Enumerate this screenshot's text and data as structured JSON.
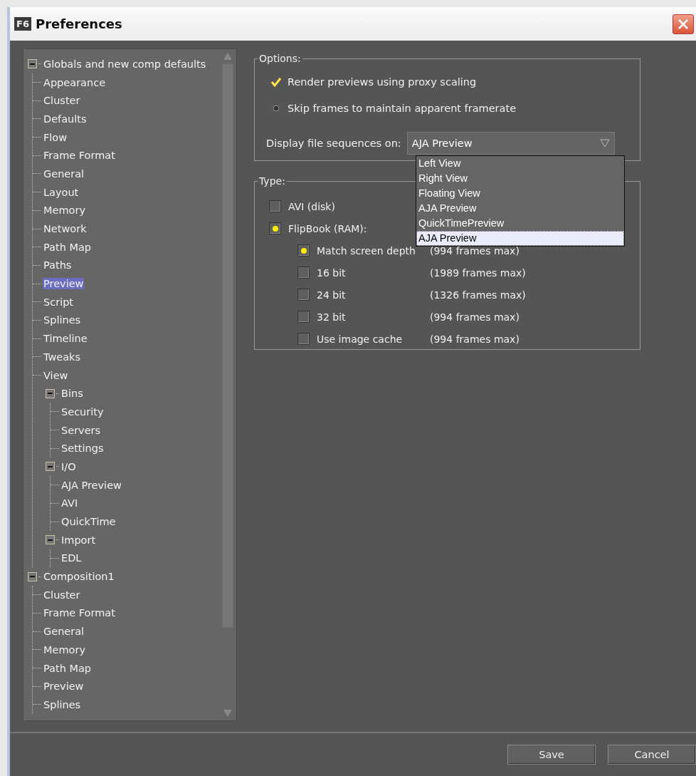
{
  "window": {
    "title": "Preferences",
    "app_icon": "F6"
  },
  "tree": [
    {
      "label": "Globals and new comp defaults",
      "selected": false,
      "expanded": true,
      "children": [
        {
          "label": "Appearance",
          "selected": false
        },
        {
          "label": "Cluster",
          "selected": false
        },
        {
          "label": "Defaults",
          "selected": false
        },
        {
          "label": "Flow",
          "selected": false
        },
        {
          "label": "Frame Format",
          "selected": false
        },
        {
          "label": "General",
          "selected": false
        },
        {
          "label": "Layout",
          "selected": false
        },
        {
          "label": "Memory",
          "selected": false
        },
        {
          "label": "Network",
          "selected": false
        },
        {
          "label": "Path Map",
          "selected": false
        },
        {
          "label": "Paths",
          "selected": false
        },
        {
          "label": "Preview",
          "selected": true
        },
        {
          "label": "Script",
          "selected": false
        },
        {
          "label": "Splines",
          "selected": false
        },
        {
          "label": "Timeline",
          "selected": false
        },
        {
          "label": "Tweaks",
          "selected": false
        },
        {
          "label": "View",
          "selected": false
        },
        {
          "label": "Bins",
          "selected": false,
          "expanded": true,
          "children": [
            {
              "label": "Security",
              "selected": false
            },
            {
              "label": "Servers",
              "selected": false
            },
            {
              "label": "Settings",
              "selected": false
            }
          ]
        },
        {
          "label": "I/O",
          "selected": false,
          "expanded": true,
          "children": [
            {
              "label": "AJA Preview",
              "selected": false
            },
            {
              "label": "AVI",
              "selected": false
            },
            {
              "label": "QuickTime",
              "selected": false
            }
          ]
        },
        {
          "label": "Import",
          "selected": false,
          "expanded": true,
          "children": [
            {
              "label": "EDL",
              "selected": false
            }
          ]
        }
      ]
    },
    {
      "label": "Composition1",
      "selected": false,
      "expanded": true,
      "children": [
        {
          "label": "Cluster",
          "selected": false
        },
        {
          "label": "Frame Format",
          "selected": false
        },
        {
          "label": "General",
          "selected": false
        },
        {
          "label": "Memory",
          "selected": false
        },
        {
          "label": "Path Map",
          "selected": false
        },
        {
          "label": "Preview",
          "selected": false
        },
        {
          "label": "Splines",
          "selected": false
        }
      ]
    }
  ],
  "options": {
    "title": "Options:",
    "items": [
      {
        "label": "Render previews using proxy scaling",
        "checked": true
      },
      {
        "label": "Skip frames to maintain apparent framerate",
        "checked": false
      }
    ],
    "display_label": "Display file sequences on:",
    "display_value": "AJA Preview",
    "dropdown_options": [
      {
        "label": "Left View",
        "selected": false
      },
      {
        "label": "Right View",
        "selected": false
      },
      {
        "label": "Floating View",
        "selected": false
      },
      {
        "label": "AJA Preview",
        "selected": false
      },
      {
        "label": "QuickTimePreview",
        "selected": false
      },
      {
        "label": "AJA Preview",
        "selected": true
      }
    ]
  },
  "type": {
    "title": "Type:",
    "items": [
      {
        "label": "AVI (disk)",
        "checked": false
      },
      {
        "label": "FlipBook (RAM):",
        "checked": true,
        "children": [
          {
            "label": "Match screen depth",
            "checked": true,
            "frames": "(994 frames max)"
          },
          {
            "label": "16 bit",
            "checked": false,
            "frames": "(1989 frames max)"
          },
          {
            "label": "24 bit",
            "checked": false,
            "frames": "(1326 frames max)"
          },
          {
            "label": "32 bit",
            "checked": false,
            "frames": "(994 frames max)"
          },
          {
            "label": "Use image cache",
            "checked": false,
            "frames": "(994 frames max)"
          }
        ]
      }
    ]
  },
  "buttons": [
    "Save",
    "Cancel"
  ]
}
